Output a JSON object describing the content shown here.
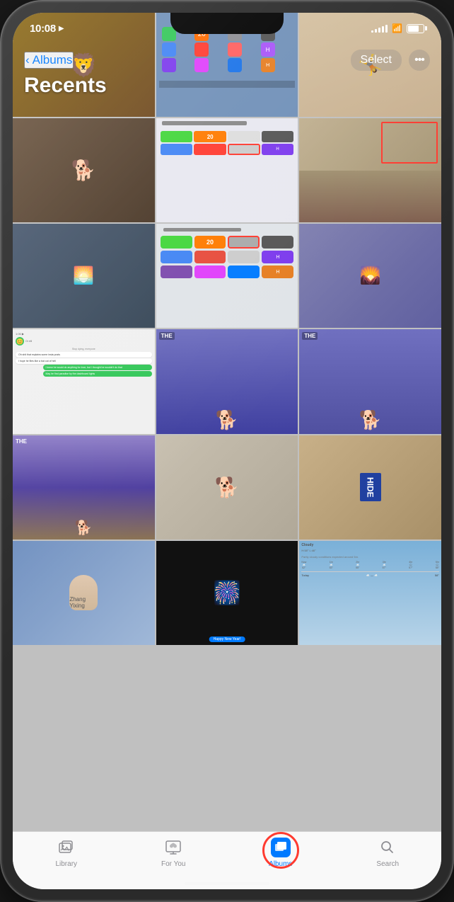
{
  "phone": {
    "status_bar": {
      "time": "10:08",
      "location_icon": "▶",
      "signal": [
        3,
        5,
        7,
        9,
        11
      ],
      "wifi": "wifi",
      "battery_level": 70
    },
    "header": {
      "back_label": "Albums",
      "title": "Recents",
      "select_button": "Select",
      "more_button": "•••"
    },
    "tabs": [
      {
        "id": "library",
        "label": "Library",
        "icon": "photo-library-icon",
        "active": false
      },
      {
        "id": "for-you",
        "label": "For You",
        "icon": "for-you-icon",
        "active": false
      },
      {
        "id": "albums",
        "label": "Albums",
        "icon": "albums-icon",
        "active": true
      },
      {
        "id": "search",
        "label": "Search",
        "icon": "search-icon",
        "active": false
      }
    ],
    "colors": {
      "accent": "#007aff",
      "tab_active": "#007aff",
      "tab_inactive": "#8e8e93",
      "alert_red": "#ff3b30"
    }
  }
}
